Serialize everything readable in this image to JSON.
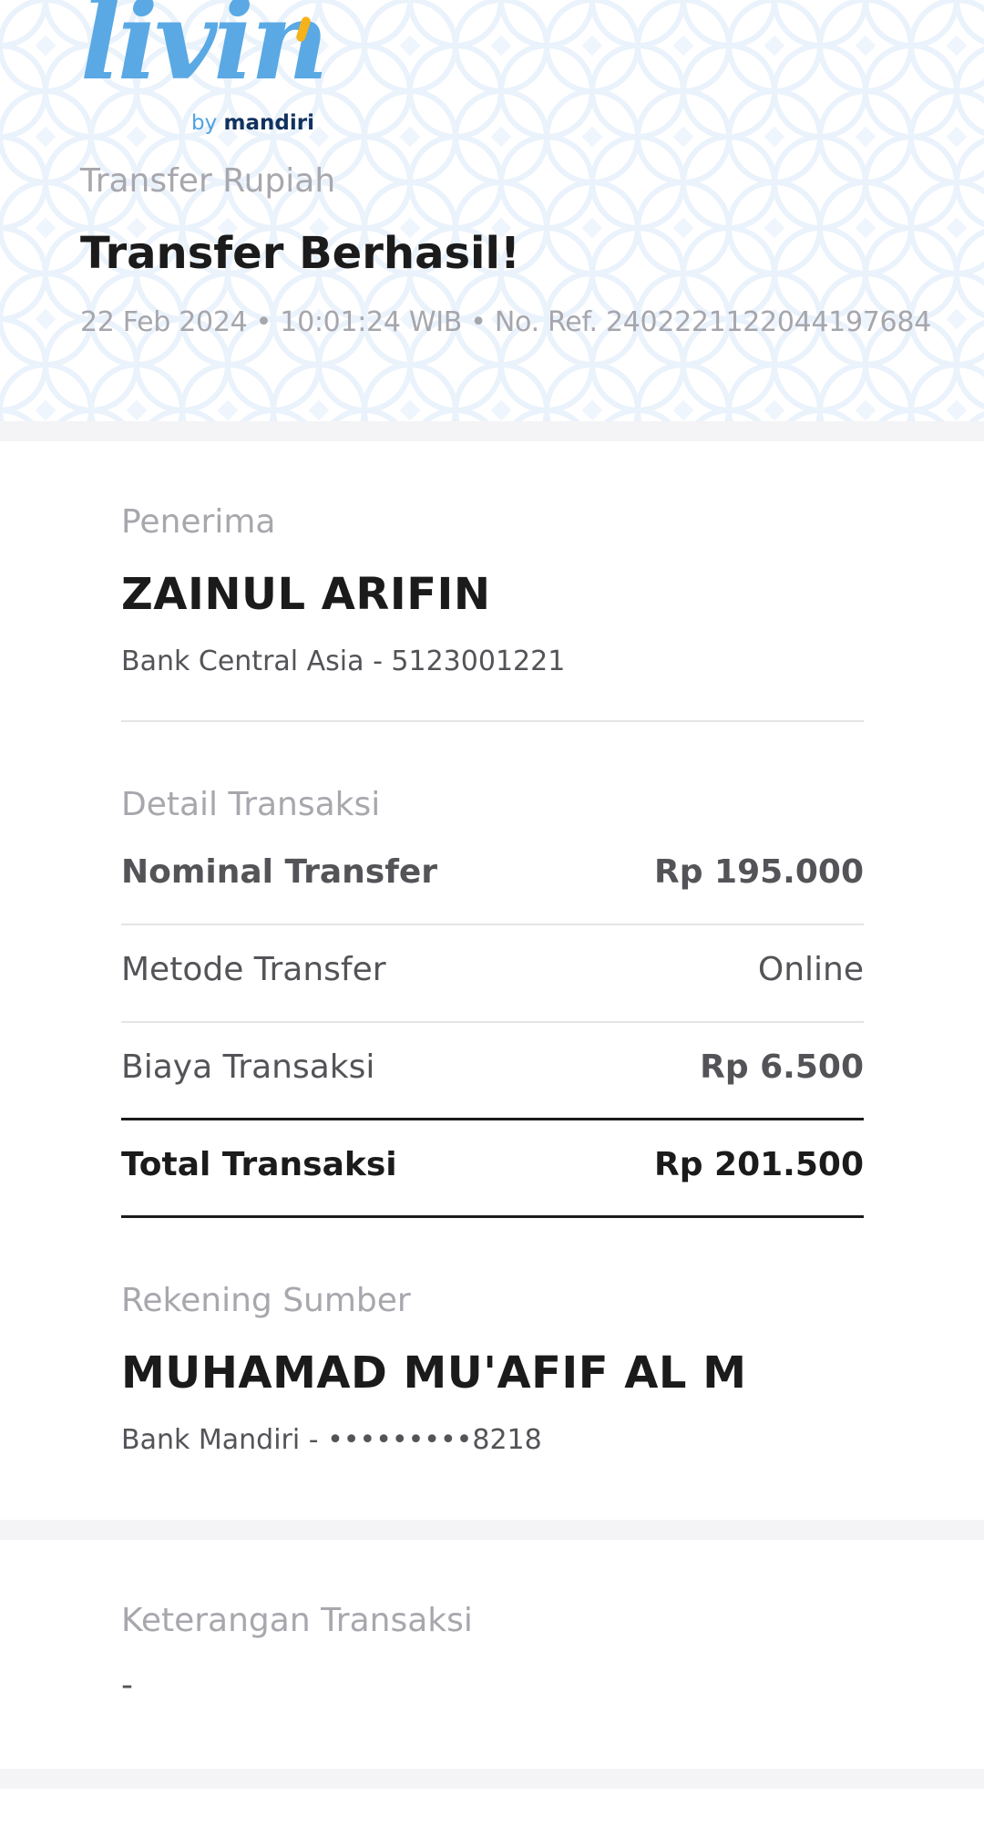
{
  "brand": {
    "logo_word": "livin",
    "logo_by": "by",
    "logo_brand": "mandiri"
  },
  "header": {
    "subtitle": "Transfer Rupiah",
    "title": "Transfer Berhasil!",
    "meta": "22 Feb 2024 • 10:01:24 WIB • No. Ref. 2402221122044197684"
  },
  "recipient": {
    "label": "Penerima",
    "name": "ZAINUL  ARIFIN",
    "bank": "Bank Central Asia - 5123001221"
  },
  "details": {
    "label": "Detail Transaksi",
    "rows": [
      {
        "key": "Nominal Transfer",
        "value": "Rp 195.000"
      },
      {
        "key": "Metode Transfer",
        "value": "Online"
      },
      {
        "key": "Biaya Transaksi",
        "value": "Rp 6.500"
      }
    ],
    "total": {
      "key": "Total Transaksi",
      "value": "Rp 201.500"
    }
  },
  "source": {
    "label": "Rekening Sumber",
    "name": "MUHAMAD MU'AFIF AL M",
    "bank": "Bank Mandiri - •••••••••8218"
  },
  "note": {
    "label": "Keterangan Transaksi",
    "value": "-"
  },
  "colors": {
    "logo_blue": "#5aa9e4",
    "logo_yellow": "#f5b21b",
    "brand_navy": "#11325f",
    "pattern": "#e9f2fb"
  }
}
